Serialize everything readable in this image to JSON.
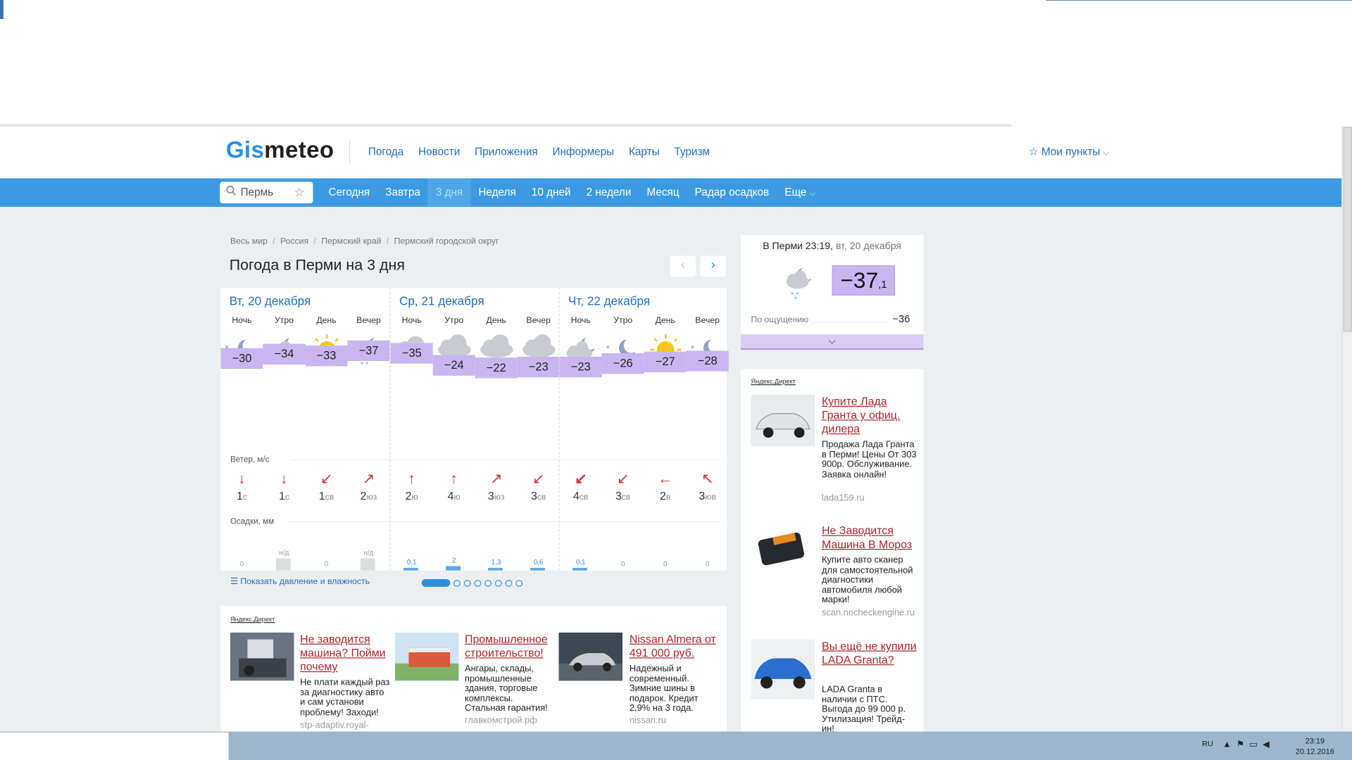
{
  "header": {
    "logo_part1": "Gis",
    "logo_part2": "meteo",
    "nav": [
      "Погода",
      "Новости",
      "Приложения",
      "Информеры",
      "Карты",
      "Туризм"
    ],
    "my_points": "Мои пункты"
  },
  "menu": {
    "search_value": "Пермь",
    "tabs": [
      "Сегодня",
      "Завтра",
      "3 дня",
      "Неделя",
      "10 дней",
      "2 недели",
      "Месяц",
      "Радар осадков",
      "Еще"
    ],
    "active_tab": "3 дня"
  },
  "breadcrumbs": [
    "Весь мир",
    "Россия",
    "Пермский край",
    "Пермский городской округ"
  ],
  "page_title": "Погода в Перми на 3 дня",
  "forecast": {
    "wind_label": "Ветер, м/с",
    "precip_label": "Осадки, мм",
    "days": [
      {
        "title": "Вт, 20 декабря",
        "periods": [
          {
            "tod": "Ночь",
            "icon": "moon-stars-icon",
            "temp": "−30",
            "wind_dir": "↓",
            "wind_speed": "1",
            "wind_code": "с",
            "precip": "0"
          },
          {
            "tod": "Утро",
            "icon": "moon-cloud-snow-icon",
            "temp": "−34",
            "wind_dir": "↓",
            "wind_speed": "1",
            "wind_code": "с",
            "precip": "н/д"
          },
          {
            "tod": "День",
            "icon": "sun-icon",
            "temp": "−33",
            "wind_dir": "↙",
            "wind_speed": "1",
            "wind_code": "св",
            "precip": "0"
          },
          {
            "tod": "Вечер",
            "icon": "moon-cloud-snow-icon",
            "temp": "−37",
            "wind_dir": "↗",
            "wind_speed": "2",
            "wind_code": "юз",
            "precip": "н/д"
          }
        ]
      },
      {
        "title": "Ср, 21 декабря",
        "periods": [
          {
            "tod": "Ночь",
            "icon": "cloud-icon",
            "temp": "−35",
            "wind_dir": "↑",
            "wind_speed": "2",
            "wind_code": "ю",
            "precip": "0,1"
          },
          {
            "tod": "Утро",
            "icon": "cloud-snow-icon",
            "temp": "−24",
            "wind_dir": "↑",
            "wind_speed": "4",
            "wind_code": "ю",
            "precip": "2"
          },
          {
            "tod": "День",
            "icon": "cloud-snow-icon",
            "temp": "−22",
            "wind_dir": "↗",
            "wind_speed": "3",
            "wind_code": "юз",
            "precip": "1,3"
          },
          {
            "tod": "Вечер",
            "icon": "cloud-snow-icon",
            "temp": "−23",
            "wind_dir": "↙",
            "wind_speed": "3",
            "wind_code": "св",
            "precip": "0,6"
          }
        ]
      },
      {
        "title": "Чт, 22 декабря",
        "periods": [
          {
            "tod": "Ночь",
            "icon": "moon-cloud-snow-icon",
            "temp": "−23",
            "wind_dir": "↙",
            "wind_speed": "4",
            "wind_code": "св",
            "precip": "0,1"
          },
          {
            "tod": "Утро",
            "icon": "moon-stars-icon",
            "temp": "−26",
            "wind_dir": "↙",
            "wind_speed": "3",
            "wind_code": "св",
            "precip": "0"
          },
          {
            "tod": "День",
            "icon": "sun-icon",
            "temp": "−27",
            "wind_dir": "←",
            "wind_speed": "2",
            "wind_code": "в",
            "precip": "0"
          },
          {
            "tod": "Вечер",
            "icon": "moon-stars-icon",
            "temp": "−28",
            "wind_dir": "↖",
            "wind_speed": "3",
            "wind_code": "юв",
            "precip": "0"
          }
        ]
      }
    ],
    "show_more": "Показать давление и влажность"
  },
  "now": {
    "title": "В Перми 23:19,",
    "date": "вт, 20 декабря",
    "temp_main": "−37",
    "temp_dec": ",1",
    "feels_label": "По ощущению",
    "feels_value": "−36"
  },
  "ads_bottom": {
    "label": "Яндекс.Директ",
    "items": [
      {
        "title": "Не заводится машина? Пойми почему",
        "text": "Не плати каждый раз за диагностику авто и сам установи проблему! Заходи!",
        "url": "stp-adaptiv.royal-"
      },
      {
        "title": "Промышленное строительство!",
        "text": "Ангары, склады, промышленные здания, торговые комплексы. Стальная гарантия!",
        "url": "главкомстрой.рф"
      },
      {
        "title": "Nissan Almera от 491 000 руб.",
        "text": "Надежный и современный. Зимние шины в подарок. Кредит 2,9% на 3 года.",
        "url": "nissan.ru"
      }
    ]
  },
  "ads_side": {
    "label": "Яндекс.Директ",
    "items": [
      {
        "title": "Купите Лада Гранта у офиц. дилера",
        "text": "Продажа Лада Гранта в Перми! Цены От 303 900р. Обслуживание. Заявка онлайн!",
        "url": "lada159.ru"
      },
      {
        "title": "Не Заводится Машина В Мороз",
        "text": "Купите авто сканер для самостоятельной диагностики автомобиля любой марки!",
        "url": "scan.nocheckengine.ru"
      },
      {
        "title": "Вы ещё не купили LADA Granta?",
        "text": "LADA Granta в наличии с ПТС. Выгода до 99 000 р. Утилизация! Трейд-ин!",
        "url": ""
      }
    ]
  },
  "taskbar": {
    "lang": "RU",
    "time": "23:19",
    "date": "20.12.2016"
  },
  "colors": {
    "accent": "#3c9ae3",
    "link": "#1f6fbf",
    "temp_band": "#c9b6f0",
    "ad_title": "#b0232a"
  }
}
